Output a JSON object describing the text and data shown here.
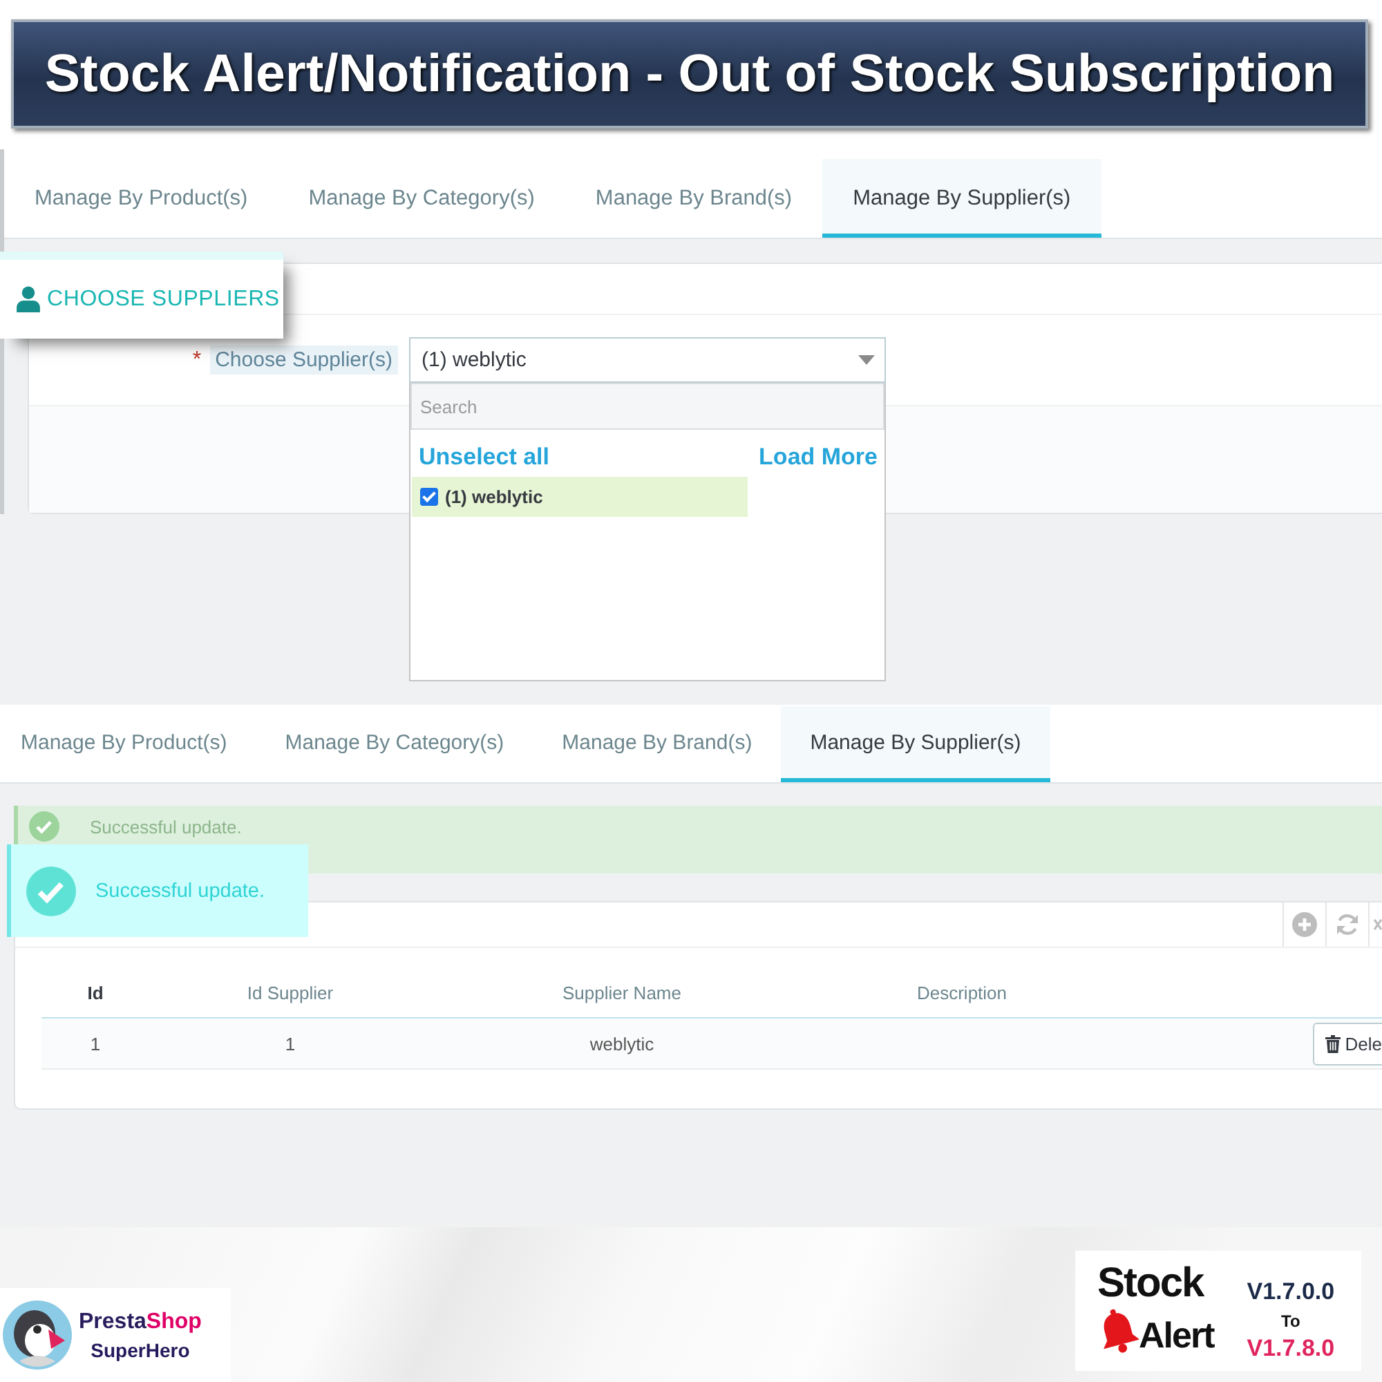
{
  "banner": {
    "title": "Stock Alert/Notification - Out of Stock Subscription"
  },
  "supplier_form_screen": {
    "tabs": [
      {
        "label": "Manage By Product(s)",
        "selected": false
      },
      {
        "label": "Manage By Category(s)",
        "selected": false
      },
      {
        "label": "Manage By Brand(s)",
        "selected": false
      },
      {
        "label": "Manage By Supplier(s)",
        "selected": true
      }
    ],
    "section_heading": "CHOOSE SUPPLIERS",
    "field": {
      "required_mark": "*",
      "label": "Choose Supplier(s)",
      "value": "(1) weblytic"
    },
    "dropdown": {
      "search": {
        "placeholder": "Search"
      },
      "unselect_all": "Unselect all",
      "load_more": "Load More",
      "options": [
        {
          "label": "(1) weblytic",
          "checked": true
        }
      ]
    }
  },
  "supplier_list_screen": {
    "tabs": [
      {
        "label": "Manage By Product(s)",
        "selected": false
      },
      {
        "label": "Manage By Category(s)",
        "selected": false
      },
      {
        "label": "Manage By Brand(s)",
        "selected": false
      },
      {
        "label": "Manage By Supplier(s)",
        "selected": true
      }
    ],
    "alert": {
      "message": "Successful update."
    },
    "toast": {
      "message": "Successful update."
    },
    "table": {
      "columns": [
        {
          "label": "Id",
          "sorted": true
        },
        {
          "label": "Id Supplier",
          "sorted": false
        },
        {
          "label": "Supplier Name",
          "sorted": false
        },
        {
          "label": "Description",
          "sorted": false
        }
      ],
      "rows": [
        {
          "cells": [
            "1",
            "1",
            "weblytic"
          ],
          "action": "Dele"
        }
      ]
    }
  },
  "logos": {
    "prestashop": {
      "wordmark": [
        "Presta",
        "Shop"
      ],
      "tagline": "SuperHero"
    },
    "stock_alert": {
      "title": "Stock",
      "subtitle": "Alert",
      "version_from": "V1.7.0.0",
      "range_word": "To",
      "version_to": "V1.7.8.0"
    }
  }
}
